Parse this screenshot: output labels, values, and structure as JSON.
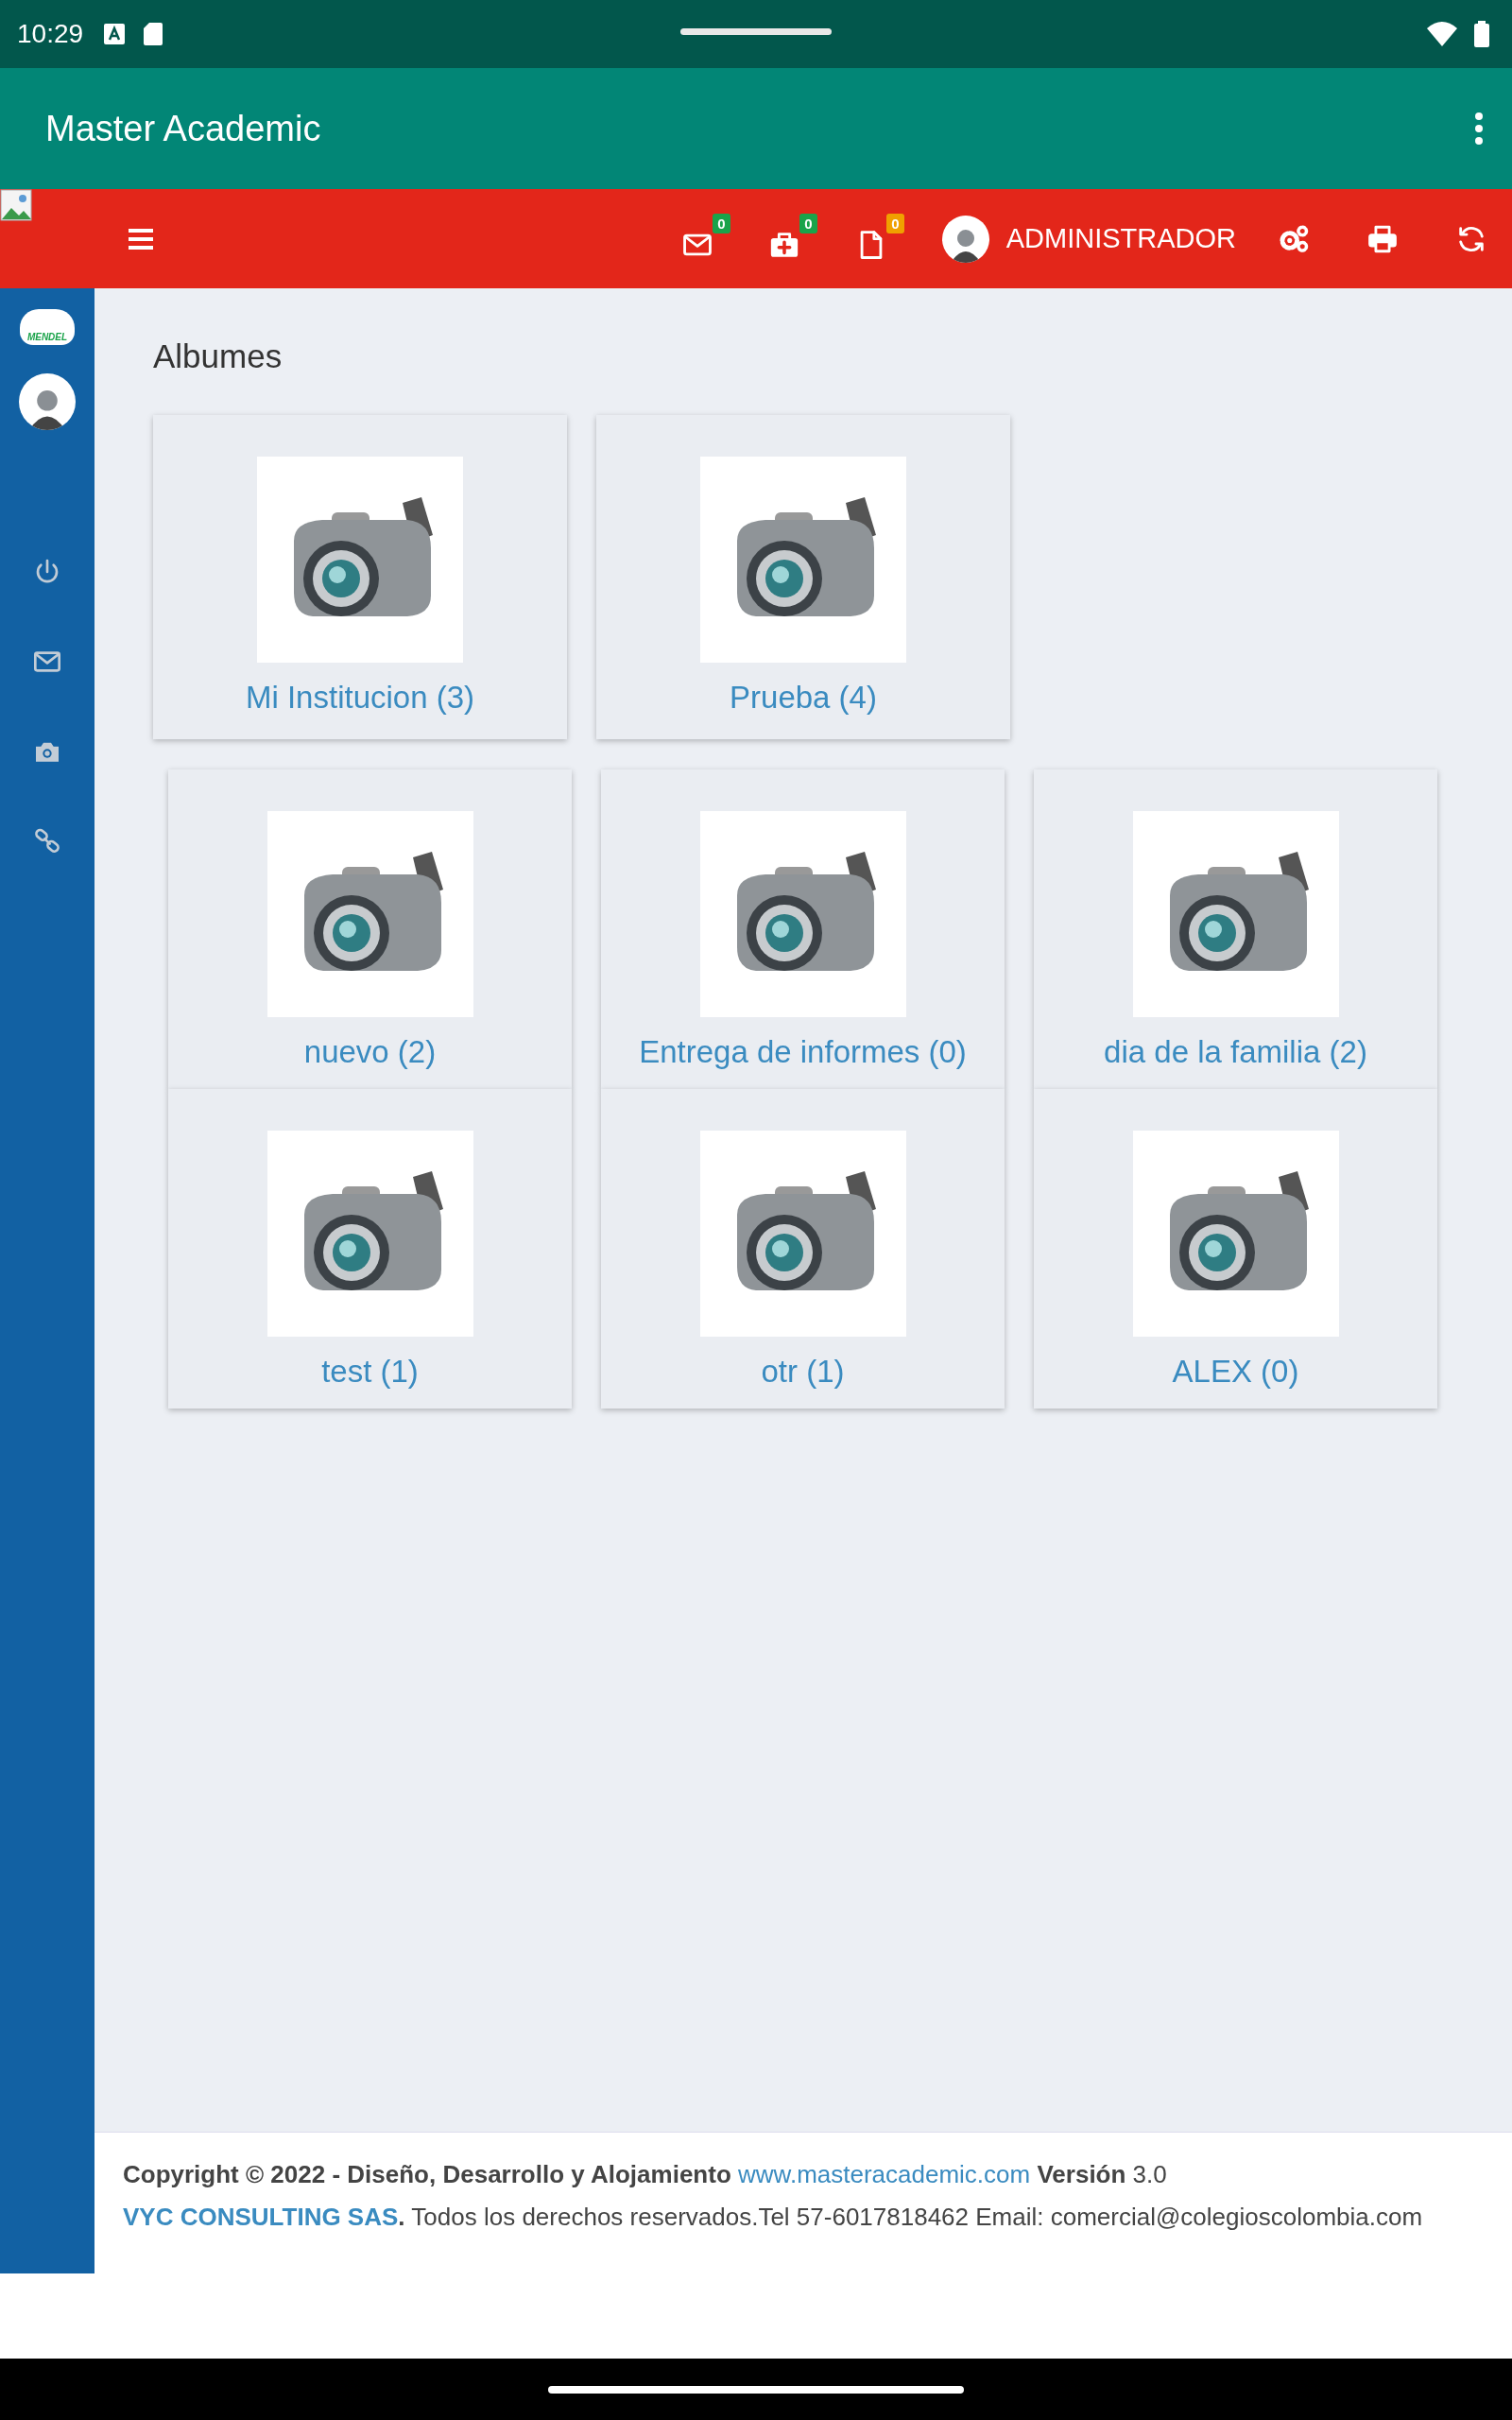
{
  "status_bar": {
    "time": "10:29"
  },
  "app_bar": {
    "title": "Master Academic"
  },
  "toolbar": {
    "notifications": [
      {
        "kind": "mail",
        "count": "0",
        "color": "#1aa34a"
      },
      {
        "kind": "medical",
        "count": "0",
        "color": "#1aa34a"
      },
      {
        "kind": "document",
        "count": "0",
        "color": "#f0a000"
      }
    ],
    "user": "ADMINISTRADOR",
    "actions": [
      {
        "kind": "settings"
      },
      {
        "kind": "print"
      },
      {
        "kind": "refresh"
      }
    ]
  },
  "sidebar": {
    "logo_text": "MENDEL",
    "items": [
      {
        "kind": "power"
      },
      {
        "kind": "mail"
      },
      {
        "kind": "camera"
      },
      {
        "kind": "link"
      }
    ]
  },
  "page": {
    "title": "Albumes",
    "album_rows": [
      {
        "albums": [
          {
            "label": "Mi Institucion (3)"
          },
          {
            "label": "Prueba (4)"
          }
        ]
      },
      {
        "albums": [
          {
            "label": "nuevo (2)"
          },
          {
            "label": "Entrega de informes (0)"
          },
          {
            "label": "dia de la familia (2)"
          }
        ]
      },
      {
        "albums": [
          {
            "label": "test (1)"
          },
          {
            "label": "otr (1)"
          },
          {
            "label": "ALEX (0)"
          }
        ]
      }
    ]
  },
  "footer": {
    "line1_before": "**Copyright © 2022 - Diseño, Desarrollo y Alojamiento**",
    "line1_link": "www.masteracademic.com",
    "line1_after": "**Versión** 3.0",
    "company": "VYC CONSULTING SAS",
    "line2_text": "**.** Todos los derechos reservados.Tel 57-6017818462 Email: comercial@colegioscolombia.com"
  }
}
